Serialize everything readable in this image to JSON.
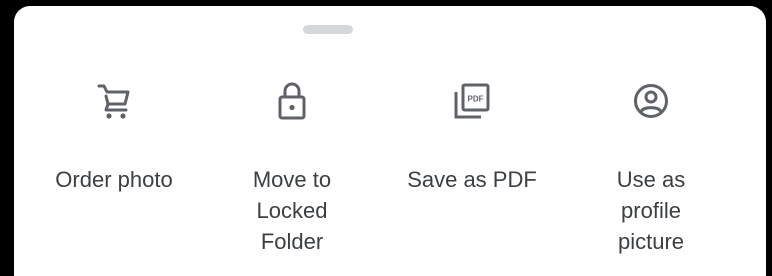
{
  "bottom_sheet": {
    "actions": [
      {
        "icon": "shopping-cart-icon",
        "label": "Order photo"
      },
      {
        "icon": "lock-icon",
        "label": "Move to\nLocked\nFolder"
      },
      {
        "icon": "pdf-icon",
        "label": "Save as PDF"
      },
      {
        "icon": "account-circle-icon",
        "label": "Use as\nprofile\npicture"
      }
    ]
  },
  "colors": {
    "icon": "#5f6368",
    "text": "#3c4043",
    "handle": "#d6d7da",
    "sheet_background": "#ffffff",
    "backdrop": "#000000"
  }
}
